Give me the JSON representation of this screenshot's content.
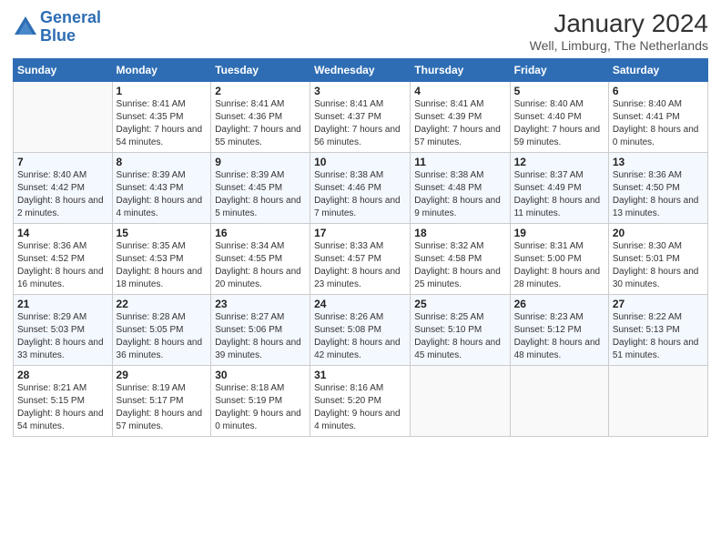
{
  "header": {
    "logo_line1": "General",
    "logo_line2": "Blue",
    "month": "January 2024",
    "location": "Well, Limburg, The Netherlands"
  },
  "days_of_week": [
    "Sunday",
    "Monday",
    "Tuesday",
    "Wednesday",
    "Thursday",
    "Friday",
    "Saturday"
  ],
  "weeks": [
    [
      {
        "num": "",
        "empty": true
      },
      {
        "num": "1",
        "sunrise": "8:41 AM",
        "sunset": "4:35 PM",
        "daylight": "7 hours and 54 minutes."
      },
      {
        "num": "2",
        "sunrise": "8:41 AM",
        "sunset": "4:36 PM",
        "daylight": "7 hours and 55 minutes."
      },
      {
        "num": "3",
        "sunrise": "8:41 AM",
        "sunset": "4:37 PM",
        "daylight": "7 hours and 56 minutes."
      },
      {
        "num": "4",
        "sunrise": "8:41 AM",
        "sunset": "4:39 PM",
        "daylight": "7 hours and 57 minutes."
      },
      {
        "num": "5",
        "sunrise": "8:40 AM",
        "sunset": "4:40 PM",
        "daylight": "7 hours and 59 minutes."
      },
      {
        "num": "6",
        "sunrise": "8:40 AM",
        "sunset": "4:41 PM",
        "daylight": "8 hours and 0 minutes."
      }
    ],
    [
      {
        "num": "7",
        "sunrise": "8:40 AM",
        "sunset": "4:42 PM",
        "daylight": "8 hours and 2 minutes."
      },
      {
        "num": "8",
        "sunrise": "8:39 AM",
        "sunset": "4:43 PM",
        "daylight": "8 hours and 4 minutes."
      },
      {
        "num": "9",
        "sunrise": "8:39 AM",
        "sunset": "4:45 PM",
        "daylight": "8 hours and 5 minutes."
      },
      {
        "num": "10",
        "sunrise": "8:38 AM",
        "sunset": "4:46 PM",
        "daylight": "8 hours and 7 minutes."
      },
      {
        "num": "11",
        "sunrise": "8:38 AM",
        "sunset": "4:48 PM",
        "daylight": "8 hours and 9 minutes."
      },
      {
        "num": "12",
        "sunrise": "8:37 AM",
        "sunset": "4:49 PM",
        "daylight": "8 hours and 11 minutes."
      },
      {
        "num": "13",
        "sunrise": "8:36 AM",
        "sunset": "4:50 PM",
        "daylight": "8 hours and 13 minutes."
      }
    ],
    [
      {
        "num": "14",
        "sunrise": "8:36 AM",
        "sunset": "4:52 PM",
        "daylight": "8 hours and 16 minutes."
      },
      {
        "num": "15",
        "sunrise": "8:35 AM",
        "sunset": "4:53 PM",
        "daylight": "8 hours and 18 minutes."
      },
      {
        "num": "16",
        "sunrise": "8:34 AM",
        "sunset": "4:55 PM",
        "daylight": "8 hours and 20 minutes."
      },
      {
        "num": "17",
        "sunrise": "8:33 AM",
        "sunset": "4:57 PM",
        "daylight": "8 hours and 23 minutes."
      },
      {
        "num": "18",
        "sunrise": "8:32 AM",
        "sunset": "4:58 PM",
        "daylight": "8 hours and 25 minutes."
      },
      {
        "num": "19",
        "sunrise": "8:31 AM",
        "sunset": "5:00 PM",
        "daylight": "8 hours and 28 minutes."
      },
      {
        "num": "20",
        "sunrise": "8:30 AM",
        "sunset": "5:01 PM",
        "daylight": "8 hours and 30 minutes."
      }
    ],
    [
      {
        "num": "21",
        "sunrise": "8:29 AM",
        "sunset": "5:03 PM",
        "daylight": "8 hours and 33 minutes."
      },
      {
        "num": "22",
        "sunrise": "8:28 AM",
        "sunset": "5:05 PM",
        "daylight": "8 hours and 36 minutes."
      },
      {
        "num": "23",
        "sunrise": "8:27 AM",
        "sunset": "5:06 PM",
        "daylight": "8 hours and 39 minutes."
      },
      {
        "num": "24",
        "sunrise": "8:26 AM",
        "sunset": "5:08 PM",
        "daylight": "8 hours and 42 minutes."
      },
      {
        "num": "25",
        "sunrise": "8:25 AM",
        "sunset": "5:10 PM",
        "daylight": "8 hours and 45 minutes."
      },
      {
        "num": "26",
        "sunrise": "8:23 AM",
        "sunset": "5:12 PM",
        "daylight": "8 hours and 48 minutes."
      },
      {
        "num": "27",
        "sunrise": "8:22 AM",
        "sunset": "5:13 PM",
        "daylight": "8 hours and 51 minutes."
      }
    ],
    [
      {
        "num": "28",
        "sunrise": "8:21 AM",
        "sunset": "5:15 PM",
        "daylight": "8 hours and 54 minutes."
      },
      {
        "num": "29",
        "sunrise": "8:19 AM",
        "sunset": "5:17 PM",
        "daylight": "8 hours and 57 minutes."
      },
      {
        "num": "30",
        "sunrise": "8:18 AM",
        "sunset": "5:19 PM",
        "daylight": "9 hours and 0 minutes."
      },
      {
        "num": "31",
        "sunrise": "8:16 AM",
        "sunset": "5:20 PM",
        "daylight": "9 hours and 4 minutes."
      },
      {
        "num": "",
        "empty": true
      },
      {
        "num": "",
        "empty": true
      },
      {
        "num": "",
        "empty": true
      }
    ]
  ]
}
